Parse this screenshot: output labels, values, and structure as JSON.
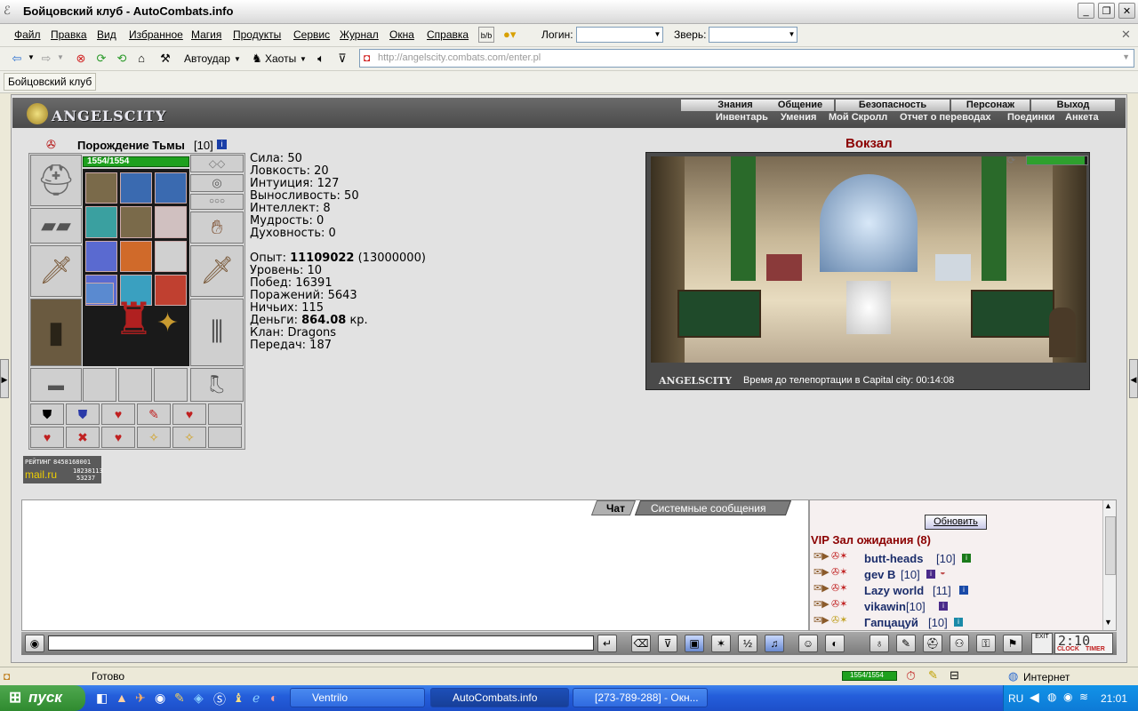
{
  "window": {
    "title": "Бойцовский клуб - AutoCombats.info"
  },
  "menubar": {
    "items": [
      "Файл",
      "Правка",
      "Вид",
      "Избранное",
      "Магия",
      "Продукты",
      "Сервис",
      "Журнал",
      "Окна",
      "Справка"
    ],
    "login_label": "Логин:",
    "beast_label": "Зверь:"
  },
  "toolbar": {
    "autoudar": "Автоудар",
    "haoty": "Хаоты",
    "address": "http://angelscity.combats.com/enter.pl"
  },
  "linksbar": {
    "tab": "Бойцовский клуб"
  },
  "site": {
    "logo": "ANGELSCITY",
    "nav_top": [
      "Знания",
      "Общение",
      "Безопасность",
      "Персонаж",
      "Выход"
    ],
    "nav_sub": [
      "Инвентарь",
      "Умения",
      "Мой Скролл",
      "Отчет о переводах",
      "Поединки",
      "Анкета"
    ]
  },
  "character": {
    "name": "Порождение Тьмы",
    "level": "[10]",
    "hp": "1554/1554",
    "stats": [
      "Сила: 50",
      "Ловкость: 20",
      "Интуиция: 127",
      "Выносливость: 50",
      "Интеллект: 8",
      "Мудрость: 0",
      "Духовность: 0"
    ],
    "exp_label": "Опыт:",
    "exp_value": "11109022",
    "exp_next": "(13000000)",
    "info": [
      "Уровень: 10",
      "Побед: 16391",
      "Поражений: 5643",
      "Ничьих: 115"
    ],
    "money_label": "Деньги:",
    "money_value": "864.08",
    "money_unit": "кр.",
    "clan": "Клан: Dragons",
    "transfers": "Передач: 187"
  },
  "rating": {
    "label": "РЕЙТИНГ",
    "num1": "8458168001",
    "logo": "mail.ru",
    "num2": "18238113",
    "num3": "53237"
  },
  "location": {
    "title": "Вокзал",
    "footer_logo": "ANGELSCITY",
    "teleport_text": "Время до телепортации в Capital city: 00:14:08"
  },
  "chat": {
    "tab_chat": "Чат",
    "tab_system": "Системные сообщения"
  },
  "roster": {
    "refresh": "Обновить",
    "room": "VIP Зал ожидания (8)",
    "players": [
      {
        "name": "butt-heads",
        "level": "[10]"
      },
      {
        "name": "gev B",
        "level": "[10]"
      },
      {
        "name": "Lazy world",
        "level": "[11]"
      },
      {
        "name": "vikawin",
        "level": "[10]"
      },
      {
        "name": "Гапцацуй",
        "level": "[10]"
      }
    ]
  },
  "bottombar": {
    "exit": "EXIT",
    "clock": "2:10",
    "clock_label": "CLOCK",
    "timer_label": "TIMER"
  },
  "statusbar": {
    "status": "Готово",
    "hp": "1554/1554",
    "zone": "Интернет"
  },
  "taskbar": {
    "start": "пуск",
    "tasks": [
      "Ventrilo",
      "AutoCombats.info",
      "[273-789-288] - Окн..."
    ],
    "lang": "RU",
    "time": "21:01"
  },
  "colors": {
    "accent_red": "#8b0000",
    "hp_green": "#1ea01e",
    "nav_bg": "#5a5a5a",
    "xp_blue": "#245edb"
  }
}
